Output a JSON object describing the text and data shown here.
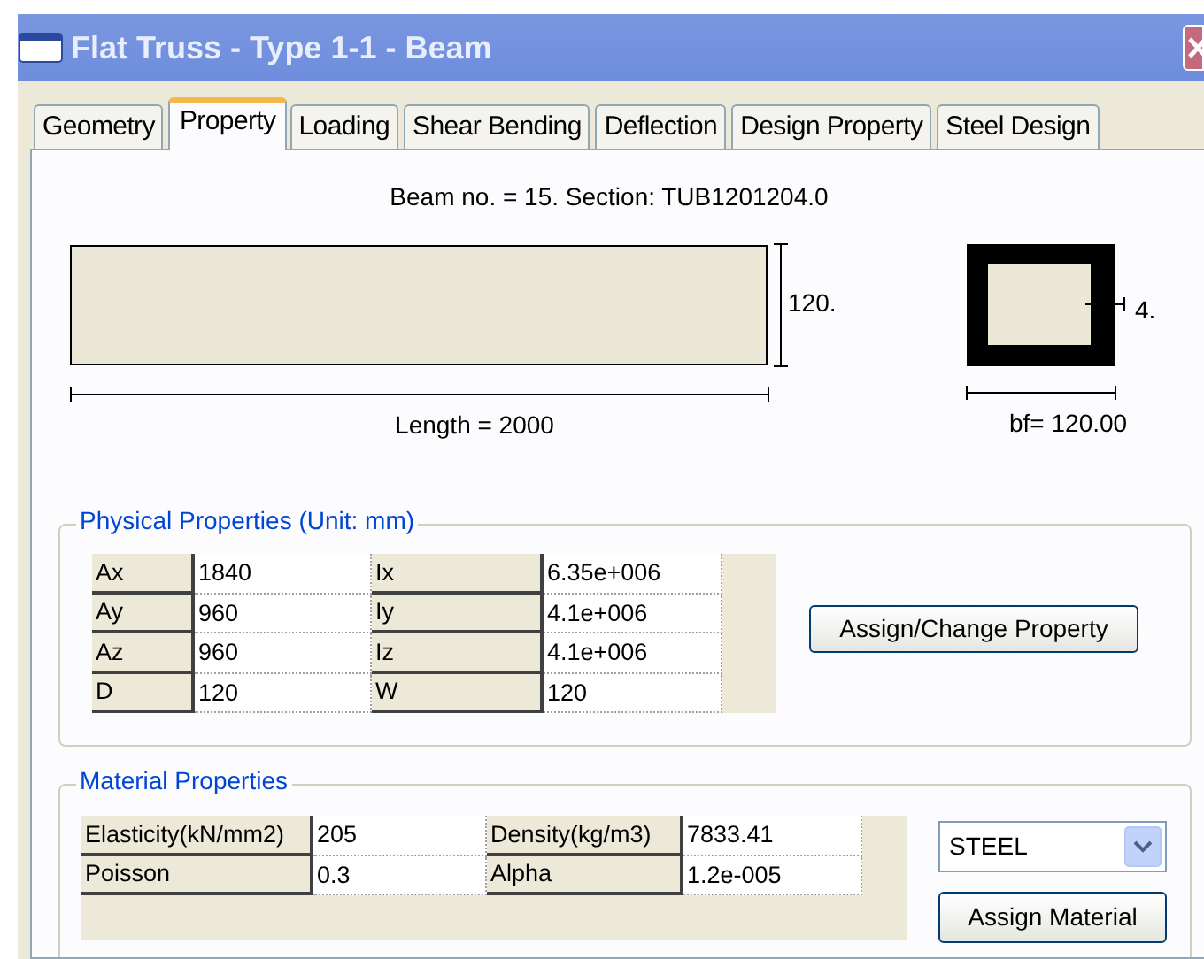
{
  "window": {
    "title": "Flat Truss - Type 1-1 - Beam"
  },
  "tabs": [
    {
      "label": "Geometry",
      "selected": false
    },
    {
      "label": "Property",
      "selected": true
    },
    {
      "label": "Loading",
      "selected": false
    },
    {
      "label": "Shear Bending",
      "selected": false
    },
    {
      "label": "Deflection",
      "selected": false
    },
    {
      "label": "Design Property",
      "selected": false
    },
    {
      "label": "Steel Design",
      "selected": false
    }
  ],
  "beam_info": "Beam no. = 15. Section: TUB1201204.0",
  "diagram": {
    "height_label": "120.",
    "length_label": "Length = 2000",
    "thickness_label": "4.",
    "width_label": "bf= 120.00"
  },
  "physical": {
    "title": "Physical Properties (Unit: mm)",
    "rows": [
      [
        {
          "label": "Ax",
          "value": "1840"
        },
        {
          "label": "Ix",
          "value": "6.35e+006"
        }
      ],
      [
        {
          "label": "Ay",
          "value": "960"
        },
        {
          "label": "Iy",
          "value": "4.1e+006"
        }
      ],
      [
        {
          "label": "Az",
          "value": "960"
        },
        {
          "label": "Iz",
          "value": "4.1e+006"
        }
      ],
      [
        {
          "label": "D",
          "value": "120"
        },
        {
          "label": "W",
          "value": "120"
        }
      ]
    ],
    "button": "Assign/Change Property"
  },
  "material": {
    "title": "Material Properties",
    "rows": [
      [
        {
          "label": "Elasticity(kN/mm2)",
          "value": "205"
        },
        {
          "label": "Density(kg/m3)",
          "value": "7833.41"
        }
      ],
      [
        {
          "label": "Poisson",
          "value": "0.3"
        },
        {
          "label": "Alpha",
          "value": "1.2e-005"
        }
      ]
    ],
    "dropdown": {
      "value": "STEEL"
    },
    "button": "Assign Material"
  }
}
